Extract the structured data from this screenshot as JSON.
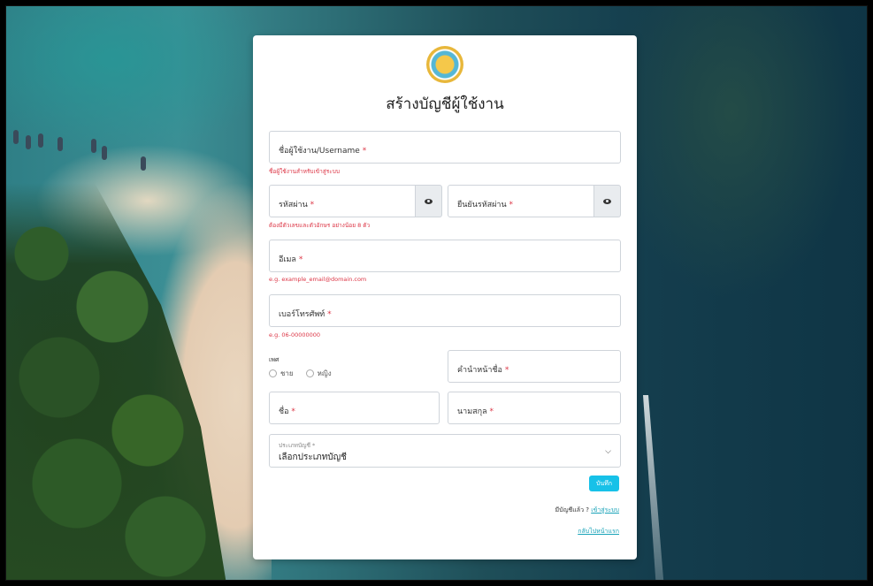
{
  "form": {
    "title": "สร้างบัญชีผู้ใช้งาน",
    "username": {
      "label": "ชื่อผู้ใช้งาน/Username",
      "required": "*",
      "help": "ชื่อผู้ใช้งานสำหรับเข้าสู่ระบบ"
    },
    "password": {
      "label": "รหัสผ่าน",
      "required": "*",
      "help": "ต้องมีตัวเลขและตัวอักษร อย่างน้อย 8 ตัว"
    },
    "confirm_password": {
      "label": "ยืนยันรหัสผ่าน",
      "required": "*"
    },
    "email": {
      "label": "อีเมล",
      "required": "*",
      "help": "e.g. example_email@domain.com"
    },
    "phone": {
      "label": "เบอร์โทรศัพท์",
      "required": "*",
      "help": "e.g. 06-00000000"
    },
    "gender": {
      "label": "เพศ",
      "option_male": "ชาย",
      "option_female": "หญิง"
    },
    "prefix": {
      "label": "คำนำหน้าชื่อ",
      "required": "*"
    },
    "first_name": {
      "label": "ชื่อ",
      "required": "*"
    },
    "last_name": {
      "label": "นามสกุล",
      "required": "*"
    },
    "account_type": {
      "label": "ประเภทบัญชี *",
      "value": "เลือกประเภทบัญชี"
    },
    "save_label": "บันทึก",
    "has_account_text": "มีบัญชีแล้ว ?",
    "login_link": "เข้าสู่ระบบ",
    "home_link": "กลับไปหน้าแรก"
  },
  "colors": {
    "accent": "#17c1e8",
    "error": "#dc3545",
    "link": "#17a2b8"
  }
}
